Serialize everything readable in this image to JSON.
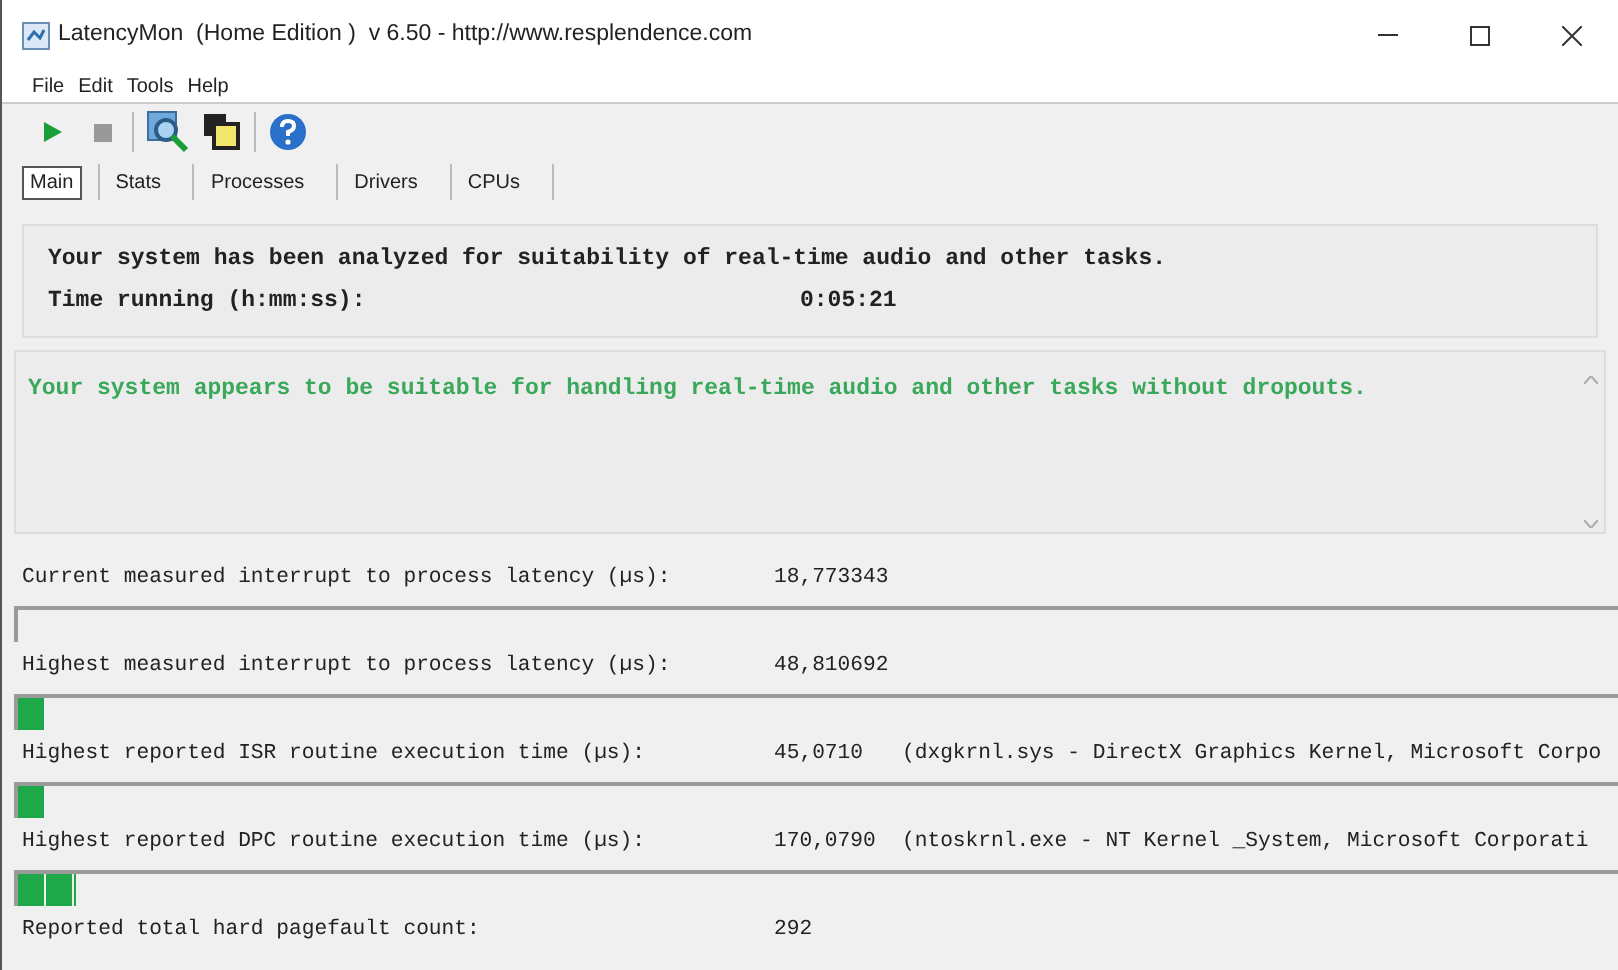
{
  "window": {
    "title": "LatencyMon  (Home Edition )  v 6.50 - http://www.resplendence.com"
  },
  "menu": [
    "File",
    "Edit",
    "Tools",
    "Help"
  ],
  "tabs": [
    {
      "label": "Main",
      "selected": true
    },
    {
      "label": "Stats",
      "selected": false
    },
    {
      "label": "Processes",
      "selected": false
    },
    {
      "label": "Drivers",
      "selected": false
    },
    {
      "label": "CPUs",
      "selected": false
    }
  ],
  "summary": {
    "line": "Your system has been analyzed for suitability of real-time audio and other tasks.",
    "time_label": "Time running (h:mm:ss):",
    "time_value": "0:05:21"
  },
  "verdict": "Your system appears to be suitable for handling real-time audio and other tasks without dropouts.",
  "metrics": [
    {
      "label": "Current measured interrupt to process latency (µs):",
      "value": "18,773343",
      "kind": "meter"
    },
    {
      "label": "Highest measured interrupt to process latency (µs):",
      "value": "48,810692",
      "kind": "meter",
      "level": 0.017
    },
    {
      "label": "Highest reported ISR routine execution time (µs):",
      "value": "45,0710",
      "detail": "(dxgkrnl.sys - DirectX Graphics Kernel, Microsoft Corpo",
      "kind": "meter",
      "level": 0.017
    },
    {
      "label": "Highest reported DPC routine execution time (µs):",
      "value": "170,0790",
      "detail": "(ntoskrnl.exe - NT Kernel _System, Microsoft Corporati",
      "kind": "meter",
      "level": 0.036
    },
    {
      "label": "Reported total hard pagefault count:",
      "value": "292",
      "kind": "plain"
    }
  ]
}
